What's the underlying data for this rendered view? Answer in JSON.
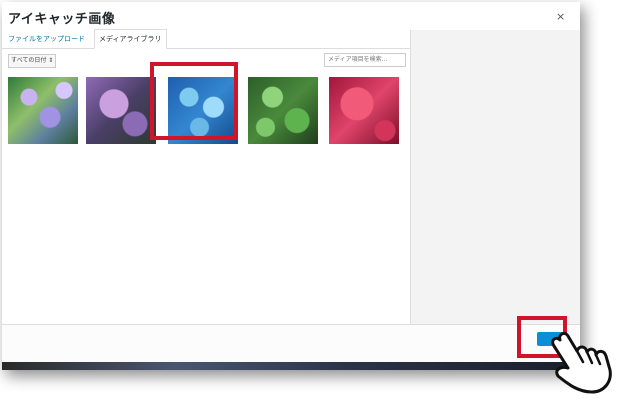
{
  "dialog": {
    "title": "アイキャッチ画像",
    "close_glyph": "×"
  },
  "tabs": [
    {
      "label": "ファイルをアップロード",
      "active": false
    },
    {
      "label": "メディアライブラリ",
      "active": true
    }
  ],
  "filter": {
    "selected": "すべての日付 ⇕"
  },
  "search": {
    "placeholder": "メディア項目を検索..."
  },
  "media_items": [
    {
      "subject": "purple-hydrangea"
    },
    {
      "subject": "violet-hydrangea"
    },
    {
      "subject": "blue-nemophila",
      "selected": true
    },
    {
      "subject": "green-clover"
    },
    {
      "subject": "pink-chrysanthemum"
    }
  ],
  "colors": {
    "highlight": "#d0142a",
    "primary_button": "#0a8fd6",
    "link": "#0073aa"
  },
  "icons": [
    "close-icon",
    "pointing-hand-icon"
  ]
}
